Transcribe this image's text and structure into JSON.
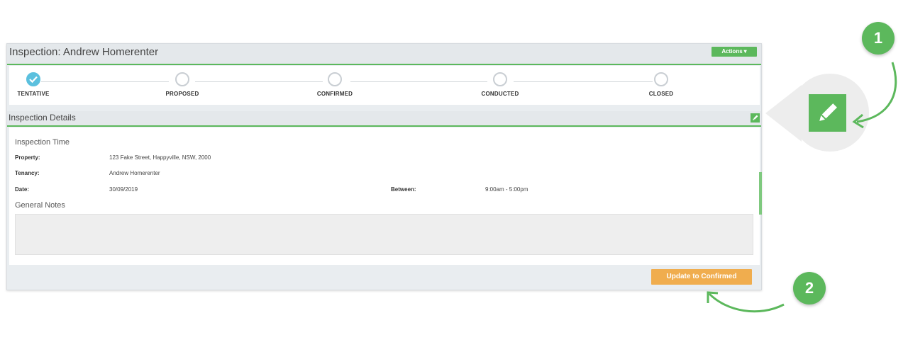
{
  "header": {
    "title": "Inspection: Andrew Homerenter",
    "actions_label": "Actions"
  },
  "steps": [
    {
      "label": "TENTATIVE",
      "status": "complete"
    },
    {
      "label": "PROPOSED",
      "status": "pending"
    },
    {
      "label": "CONFIRMED",
      "status": "pending"
    },
    {
      "label": "CONDUCTED",
      "status": "pending"
    },
    {
      "label": "CLOSED",
      "status": "pending"
    }
  ],
  "details": {
    "section_title": "Inspection Details",
    "time_heading": "Inspection Time",
    "property_label": "Property:",
    "property_value": "123 Fake Street, Happyville, NSW, 2000",
    "tenancy_label": "Tenancy:",
    "tenancy_value": "Andrew Homerenter",
    "date_label": "Date:",
    "date_value": "30/09/2019",
    "between_label": "Between:",
    "between_value": "9:00am - 5:00pm",
    "notes_heading": "General Notes",
    "notes_value": ""
  },
  "footer": {
    "update_label": "Update to Confirmed"
  },
  "annotations": {
    "badge_1": "1",
    "badge_2": "2"
  },
  "colors": {
    "accent_green": "#5cb85c",
    "step_complete": "#5bc0de",
    "update_orange": "#f0ad4e"
  },
  "icons": {
    "actions_chevron": "chevron-down-icon",
    "step_done": "check-icon",
    "edit": "pencil-icon"
  }
}
